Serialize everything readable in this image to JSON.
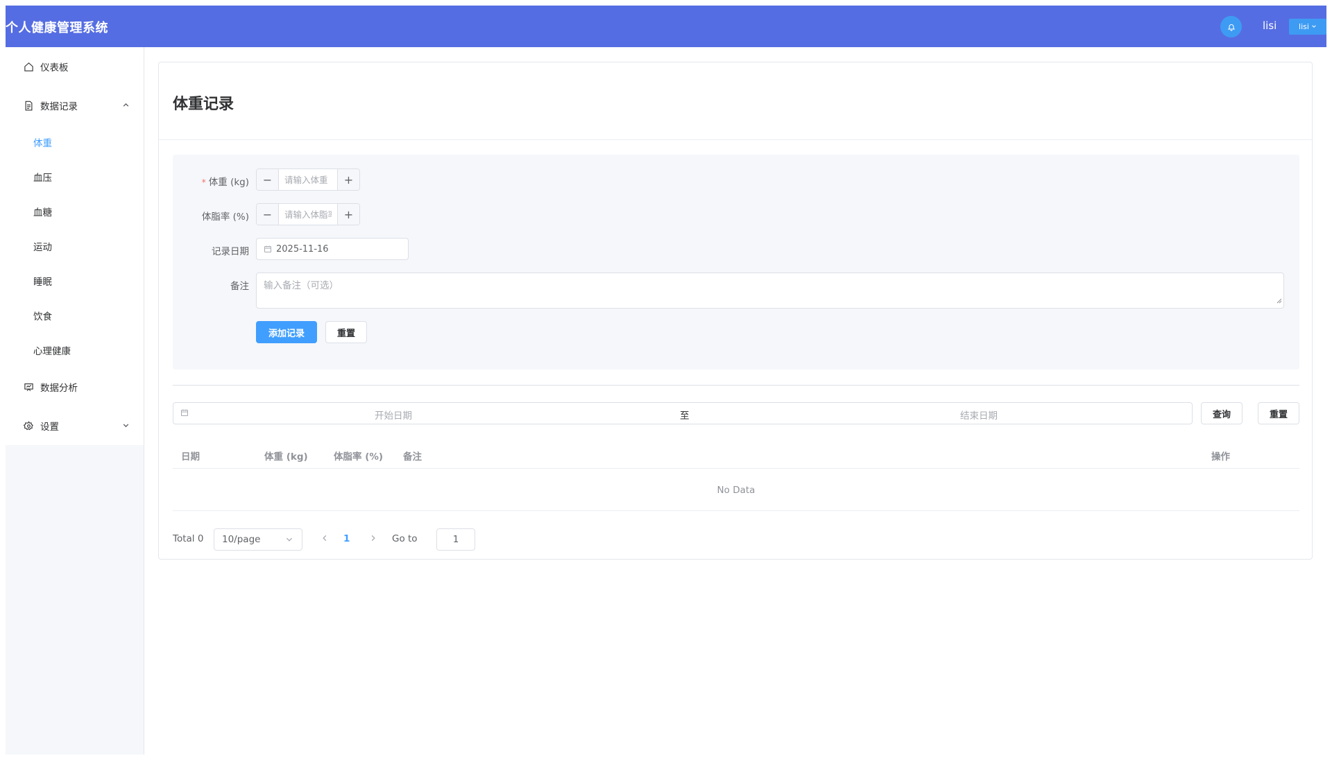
{
  "header": {
    "app_title": "个人健康管理系统",
    "username": "lisi",
    "user_menu_label": "lisi"
  },
  "sidebar": {
    "items": [
      {
        "label": "仪表板",
        "icon": "home-icon"
      },
      {
        "label": "数据记录",
        "icon": "document-icon",
        "expanded": true
      },
      {
        "label": "数据分析",
        "icon": "chart-icon"
      },
      {
        "label": "设置",
        "icon": "gear-icon",
        "expanded": false
      }
    ],
    "sub_items": [
      "体重",
      "血压",
      "血糖",
      "运动",
      "睡眠",
      "饮食",
      "心理健康"
    ],
    "active_sub": "体重"
  },
  "page": {
    "title": "体重记录"
  },
  "form": {
    "weight_label": "体重 (kg)",
    "weight_placeholder": "请输入体重",
    "fat_label": "体脂率 (%)",
    "fat_placeholder": "请输入体脂率",
    "date_label": "记录日期",
    "date_value": "2025-11-16",
    "note_label": "备注",
    "note_placeholder": "输入备注（可选）",
    "add_button": "添加记录",
    "reset_button": "重置"
  },
  "filter": {
    "start_placeholder": "开始日期",
    "separator": "至",
    "end_placeholder": "结束日期",
    "query_button": "查询",
    "reset_button": "重置"
  },
  "table": {
    "columns": [
      "日期",
      "体重 (kg)",
      "体脂率 (%)",
      "备注",
      "操作"
    ],
    "empty_text": "No Data"
  },
  "pagination": {
    "total": "Total 0",
    "page_size": "10/page",
    "current_page": "1",
    "goto_label": "Go to",
    "goto_value": "1"
  },
  "colors": {
    "header_bg": "#556de2",
    "primary": "#409eff"
  }
}
